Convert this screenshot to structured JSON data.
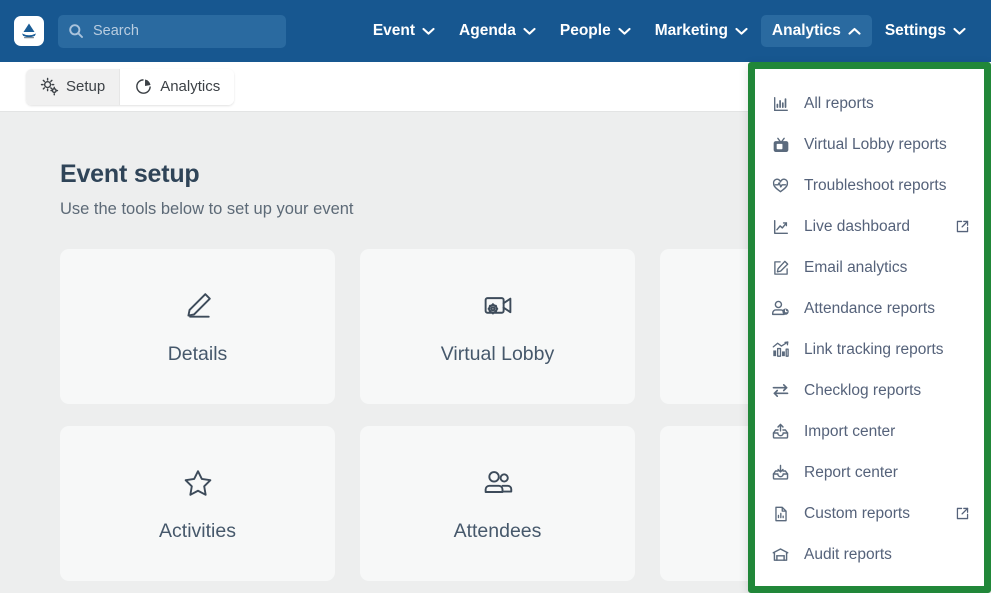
{
  "colors": {
    "navbar_blue": "#175790",
    "nav_active_pill": "#2a6aa0",
    "dropdown_highlight_green": "#218739",
    "content_bg": "#edeeee",
    "card_bg": "#f7f8f8",
    "title_text": "#2f4458",
    "menu_text": "#55627a"
  },
  "topnav": {
    "logo_name": "app-logo",
    "search": {
      "placeholder": "Search",
      "value": "",
      "icon": "search-icon"
    },
    "items": [
      {
        "label": "Event",
        "icon": "chevron-down-icon",
        "active": false
      },
      {
        "label": "Agenda",
        "icon": "chevron-down-icon",
        "active": false
      },
      {
        "label": "People",
        "icon": "chevron-down-icon",
        "active": false
      },
      {
        "label": "Marketing",
        "icon": "chevron-down-icon",
        "active": false
      },
      {
        "label": "Analytics",
        "icon": "chevron-up-icon",
        "active": true
      },
      {
        "label": "Settings",
        "icon": "chevron-down-icon",
        "active": false
      }
    ]
  },
  "subnav": {
    "tabs": [
      {
        "label": "Setup",
        "icon": "gears-icon",
        "selected": true
      },
      {
        "label": "Analytics",
        "icon": "pie-chart-icon",
        "selected": false
      }
    ]
  },
  "main": {
    "title": "Event setup",
    "subtitle": "Use the tools below to set up your event",
    "cards": [
      {
        "label": "Details",
        "icon": "pencil-icon"
      },
      {
        "label": "Virtual Lobby",
        "icon": "video-camera-gear-icon"
      },
      {
        "label": "",
        "icon": ""
      },
      {
        "label": "Activities",
        "icon": "star-icon"
      },
      {
        "label": "Attendees",
        "icon": "people-icon"
      },
      {
        "label": "",
        "icon": ""
      }
    ]
  },
  "dropdown": {
    "name": "analytics-menu",
    "items": [
      {
        "label": "All reports",
        "icon": "bar-chart-icon",
        "external": false
      },
      {
        "label": "Virtual Lobby reports",
        "icon": "television-icon",
        "external": false
      },
      {
        "label": "Troubleshoot reports",
        "icon": "heart-pulse-icon",
        "external": false
      },
      {
        "label": "Live dashboard",
        "icon": "line-chart-icon",
        "external": true
      },
      {
        "label": "Email analytics",
        "icon": "edit-square-icon",
        "external": false
      },
      {
        "label": "Attendance reports",
        "icon": "user-clock-icon",
        "external": false
      },
      {
        "label": "Link tracking reports",
        "icon": "chart-trend-bars-icon",
        "external": false
      },
      {
        "label": "Checklog reports",
        "icon": "exchange-arrows-icon",
        "external": false
      },
      {
        "label": "Import center",
        "icon": "import-tray-icon",
        "external": false
      },
      {
        "label": "Report center",
        "icon": "download-tray-icon",
        "external": false
      },
      {
        "label": "Custom reports",
        "icon": "document-chart-icon",
        "external": true
      },
      {
        "label": "Audit reports",
        "icon": "archive-box-icon",
        "external": false
      }
    ],
    "external_icon": "external-link-icon"
  }
}
